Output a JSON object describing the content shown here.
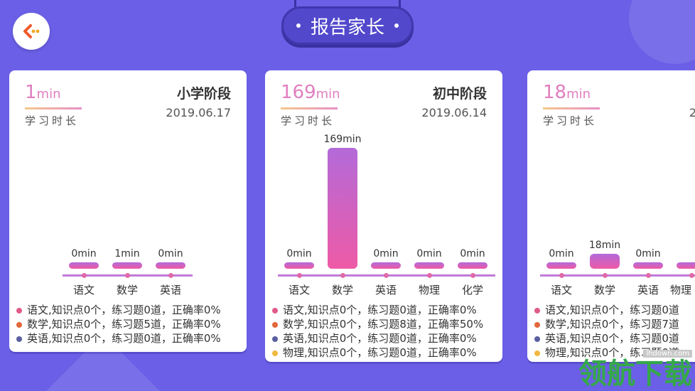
{
  "header": {
    "title": "报告家长"
  },
  "cards": [
    {
      "minutes_value": "1",
      "minutes_unit": "min",
      "time_label": "学习时长",
      "stage": "小学阶段",
      "date": "2019.06.17",
      "subjects": [
        {
          "name": "语文",
          "value_label": "0min"
        },
        {
          "name": "数学",
          "value_label": "1min"
        },
        {
          "name": "英语",
          "value_label": "0min"
        }
      ],
      "legend": [
        {
          "text": "语文,知识点0个，练习题0道，正确率0%",
          "color": "#e05a8a"
        },
        {
          "text": "数学,知识点0个，练习题5道，正确率0%",
          "color": "#e2683a"
        },
        {
          "text": "英语,知识点0个，练习题0道，正确率0%",
          "color": "#5a5fa0"
        }
      ]
    },
    {
      "minutes_value": "169",
      "minutes_unit": "min",
      "time_label": "学习时长",
      "stage": "初中阶段",
      "date": "2019.06.14",
      "subjects": [
        {
          "name": "语文",
          "value_label": "0min"
        },
        {
          "name": "数学",
          "value_label": "169min"
        },
        {
          "name": "英语",
          "value_label": "0min"
        },
        {
          "name": "物理",
          "value_label": "0min"
        },
        {
          "name": "化学",
          "value_label": "0min"
        }
      ],
      "legend": [
        {
          "text": "语文,知识点0个，练习题0道，正确率0%",
          "color": "#e05a8a"
        },
        {
          "text": "数学,知识点0个，练习题8道，正确率50%",
          "color": "#e2683a"
        },
        {
          "text": "英语,知识点0个，练习题0道，正确率0%",
          "color": "#5a5fa0"
        },
        {
          "text": "物理,知识点0个，练习题0道，正确率0%",
          "color": "#f0b840"
        }
      ]
    },
    {
      "minutes_value": "18",
      "minutes_unit": "min",
      "time_label": "学习时长",
      "stage": "",
      "date": "2",
      "subjects": [
        {
          "name": "语文",
          "value_label": "0min"
        },
        {
          "name": "数学",
          "value_label": "18min"
        },
        {
          "name": "英语",
          "value_label": "0min"
        },
        {
          "name": "物理",
          "value_label": ""
        }
      ],
      "legend": [
        {
          "text": "语文,知识点0个，练习题0道",
          "color": "#e05a8a"
        },
        {
          "text": "数学,知识点0个，练习题7道",
          "color": "#e2683a"
        },
        {
          "text": "英语,知识点0个，练习题0道",
          "color": "#5a5fa0"
        },
        {
          "text": "物理,知识点0个，练习题0道",
          "color": "#f0b840"
        }
      ]
    }
  ],
  "chart_data": [
    {
      "type": "bar",
      "categories": [
        "语文",
        "数学",
        "英语"
      ],
      "values": [
        0,
        1,
        0
      ],
      "unit": "min"
    },
    {
      "type": "bar",
      "categories": [
        "语文",
        "数学",
        "英语",
        "物理",
        "化学"
      ],
      "values": [
        0,
        169,
        0,
        0,
        0
      ],
      "unit": "min"
    },
    {
      "type": "bar",
      "categories": [
        "语文",
        "数学",
        "英语",
        "物理"
      ],
      "values": [
        0,
        18,
        0,
        0
      ],
      "unit": "min"
    }
  ],
  "watermark": {
    "small": "lhdown.com",
    "big": "领航下载"
  }
}
